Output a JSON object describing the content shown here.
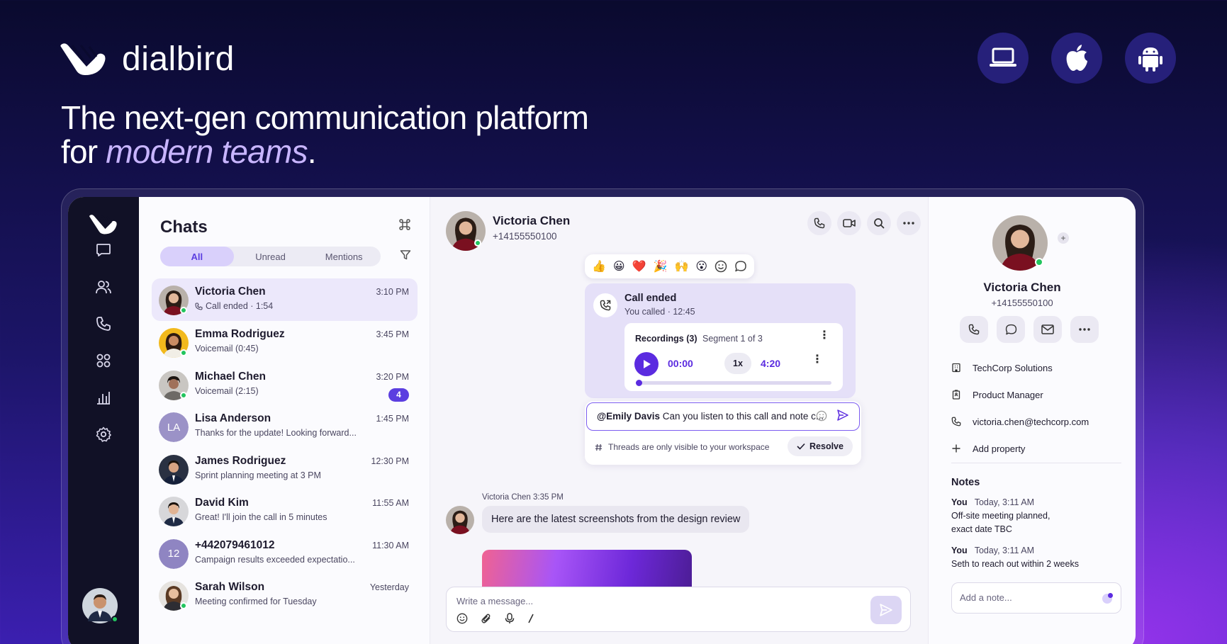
{
  "brand": {
    "name": "dialbird"
  },
  "hero": {
    "headline_line1": "The next-gen communication platform",
    "headline_prefix": "for ",
    "headline_emphasis": "modern teams",
    "headline_suffix": "."
  },
  "platforms": [
    "laptop-icon",
    "apple-icon",
    "android-icon"
  ],
  "colors": {
    "accent": "#5b2be0",
    "online": "#22c55e",
    "rail": "#111126"
  },
  "rail": {
    "items": [
      "chat-icon",
      "contacts-icon",
      "phone-icon",
      "apps-icon",
      "analytics-icon",
      "settings-icon"
    ]
  },
  "chats": {
    "title": "Chats",
    "tabs": [
      {
        "label": "All",
        "active": true
      },
      {
        "label": "Unread"
      },
      {
        "label": "Mentions"
      }
    ],
    "rows": [
      {
        "name": "Victoria Chen",
        "time": "3:10 PM",
        "preview": "Call ended · 1:54",
        "online": true,
        "selected": true
      },
      {
        "name": "Emma Rodriguez",
        "time": "3:45 PM",
        "preview": "Voicemail (0:45)",
        "online": true
      },
      {
        "name": "Michael Chen",
        "time": "3:20 PM",
        "preview": "Voicemail (2:15)",
        "online": true,
        "badge": "4"
      },
      {
        "name": "Lisa Anderson",
        "time": "1:45 PM",
        "preview": "Thanks for the update! Looking forward...",
        "initials": "LA"
      },
      {
        "name": "James Rodriguez",
        "time": "12:30 PM",
        "preview": "Sprint planning meeting at 3 PM"
      },
      {
        "name": "David Kim",
        "time": "11:55 AM",
        "preview": "Great! I'll join the call in 5 minutes"
      },
      {
        "name": "+442079461012",
        "time": "11:30 AM",
        "preview": "Campaign results exceeded expectatio...",
        "initials": "12"
      },
      {
        "name": "Sarah Wilson",
        "time": "Yesterday",
        "preview": "Meeting confirmed for Tuesday",
        "online": true
      }
    ]
  },
  "conversation": {
    "name": "Victoria Chen",
    "phone": "+14155550100",
    "reactions": [
      "👍",
      "😀",
      "❤️",
      "🎉",
      "🙌",
      "😮"
    ],
    "call": {
      "title": "Call ended",
      "subtitle": "You called · 12:45"
    },
    "recordings": {
      "title": "Recordings (3)",
      "segment": "Segment 1 of 3",
      "current": "00:00",
      "speed": "1x",
      "duration": "4:20",
      "progress": 0
    },
    "thread": {
      "mention": "@Emily Davis",
      "text": " Can you listen to this call and note c...",
      "note": "Threads are only visible to your workspace",
      "resolve": "Resolve"
    },
    "message": {
      "meta": "Victoria Chen 3:35 PM",
      "text": "Here are the latest screenshots from the design review"
    },
    "composer": {
      "placeholder": "Write a message..."
    }
  },
  "profile": {
    "name": "Victoria Chen",
    "phone": "+14155550100",
    "company": "TechCorp Solutions",
    "role": "Product Manager",
    "email": "victoria.chen@techcorp.com",
    "add_property": "Add property",
    "notes_title": "Notes",
    "notes": [
      {
        "author": "You",
        "time": "Today, 3:11 AM",
        "text1": "Off-site meeting planned,",
        "text2": "exact date TBC"
      },
      {
        "author": "You",
        "time": "Today, 3:11 AM",
        "text1": "Seth to reach out within 2 weeks",
        "text2": ""
      }
    ],
    "note_placeholder": "Add a note..."
  }
}
